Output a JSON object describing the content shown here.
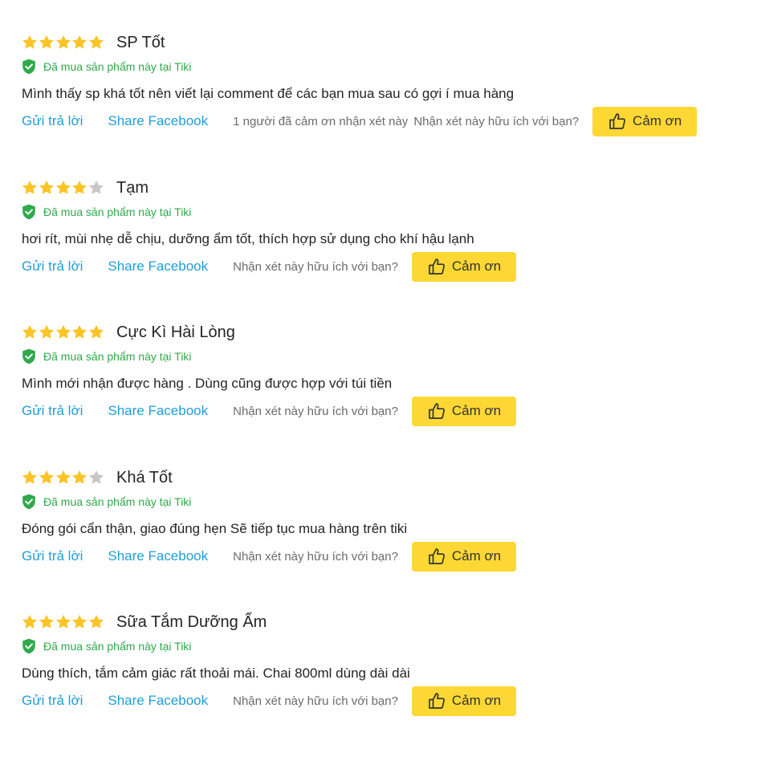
{
  "colors": {
    "star_filled": "#fdc426",
    "star_empty": "#c7c7c7",
    "verified": "#2ea94b",
    "link": "#1f9ed9",
    "button": "#fdd835"
  },
  "icons": {
    "star": "star-icon",
    "verified": "shield-check-icon",
    "thanks": "thumbs-up-icon"
  },
  "reviews": [
    {
      "rating": 5,
      "title": "SP Tốt",
      "verified_text": "Đã mua sản phẩm này tại Tiki",
      "body": "Mình thấy sp khá tốt nên viết lại comment để các bạn mua sau có gợi í mua hàng",
      "reply_label": "Gửi trả lời",
      "share_label": "Share Facebook",
      "thanks_count": "1 người đã cảm ơn nhận xét này",
      "helpful_question": "Nhận xét này hữu ích với bạn?",
      "thanks_label": "Cảm ơn"
    },
    {
      "rating": 4,
      "title": "Tạm",
      "verified_text": "Đã mua sản phẩm này tại Tiki",
      "body": "hơi rít, mùi nhẹ dễ chịu, dưỡng ẩm tốt, thích hợp sử dụng cho khí hậu lạnh",
      "reply_label": "Gửi trả lời",
      "share_label": "Share Facebook",
      "thanks_count": "",
      "helpful_question": "Nhận xét này hữu ích với bạn?",
      "thanks_label": "Cảm ơn"
    },
    {
      "rating": 5,
      "title": "Cực Kì Hài Lòng",
      "verified_text": "Đã mua sản phẩm này tại Tiki",
      "body": "Mình mới nhận được hàng . Dùng cũng được hợp với túi tiền",
      "reply_label": "Gửi trả lời",
      "share_label": "Share Facebook",
      "thanks_count": "",
      "helpful_question": "Nhận xét này hữu ích với bạn?",
      "thanks_label": "Cảm ơn"
    },
    {
      "rating": 4,
      "title": "Khá Tốt",
      "verified_text": "Đã mua sản phẩm này tại Tiki",
      "body": "Đóng gói cẩn thận, giao đúng hẹn Sẽ tiếp tục mua hàng trên tiki",
      "reply_label": "Gửi trả lời",
      "share_label": "Share Facebook",
      "thanks_count": "",
      "helpful_question": "Nhận xét này hữu ích với bạn?",
      "thanks_label": "Cảm ơn"
    },
    {
      "rating": 5,
      "title": "Sữa Tắm Dưỡng Ẩm",
      "verified_text": "Đã mua sản phẩm này tại Tiki",
      "body": "Dùng thích, tắm cảm giác rất thoải mái. Chai 800ml dùng dài dài",
      "reply_label": "Gửi trả lời",
      "share_label": "Share Facebook",
      "thanks_count": "",
      "helpful_question": "Nhận xét này hữu ích với bạn?",
      "thanks_label": "Cảm ơn"
    }
  ]
}
